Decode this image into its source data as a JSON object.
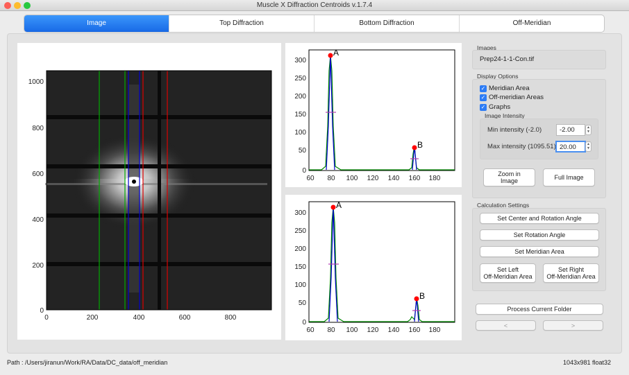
{
  "window": {
    "title": "Muscle X Diffraction Centroids v.1.7.4"
  },
  "tabs": [
    {
      "label": "Image",
      "active": true
    },
    {
      "label": "Top Diffraction",
      "active": false
    },
    {
      "label": "Bottom Diffraction",
      "active": false
    },
    {
      "label": "Off-Meridian",
      "active": false
    }
  ],
  "image_plot": {
    "y_ticks": [
      "1000",
      "800",
      "600",
      "400",
      "200",
      "0"
    ],
    "x_ticks": [
      "0",
      "200",
      "400",
      "600",
      "800"
    ],
    "meridian_color": "#0000cc",
    "left_off_meridian_color": "#008800",
    "right_off_meridian_color": "#dd0000"
  },
  "top_plot": {
    "y_ticks": [
      "300",
      "250",
      "200",
      "150",
      "100",
      "50",
      "0"
    ],
    "x_ticks": [
      "60",
      "80",
      "100",
      "120",
      "140",
      "160",
      "180"
    ],
    "peak_labels": [
      "A",
      "B"
    ],
    "peaks": [
      {
        "x": 80,
        "y": 310
      },
      {
        "x": 160,
        "y": 60
      }
    ]
  },
  "bottom_plot": {
    "y_ticks": [
      "300",
      "250",
      "200",
      "150",
      "100",
      "50",
      "0"
    ],
    "x_ticks": [
      "60",
      "80",
      "100",
      "120",
      "140",
      "160",
      "180"
    ],
    "peak_labels": [
      "A",
      "B"
    ],
    "peaks": [
      {
        "x": 82,
        "y": 312
      },
      {
        "x": 163,
        "y": 62
      }
    ]
  },
  "images": {
    "group": "Images",
    "filename": "Prep24-1-1-Con.tif"
  },
  "display": {
    "group": "Display Options",
    "meridian": "Meridian Area",
    "off_meridian": "Off-meridian Areas",
    "graphs": "Graphs",
    "intensity_group": "Image Intensity",
    "min_label": "Min intensity (-2.0)",
    "min_value": "-2.00",
    "max_label": "Max intensity (1095.51)",
    "max_value": "20.00",
    "zoom_btn": "Zoom in\nImage",
    "full_btn": "Full Image"
  },
  "calc": {
    "group": "Calculation Settings",
    "center_btn": "Set Center and Rotation Angle",
    "rotation_btn": "Set Rotation Angle",
    "meridian_btn": "Set Meridian Area",
    "left_btn": "Set Left\nOff-Meridian Area",
    "right_btn": "Set Right\nOff-Meridian Area"
  },
  "process_btn": "Process Current Folder",
  "prev_btn": "<",
  "next_btn": ">",
  "status": {
    "path": "Path : /Users/jiranun/Work/RA/Data/DC_data/off_meridian",
    "info": "1043x981 float32"
  }
}
